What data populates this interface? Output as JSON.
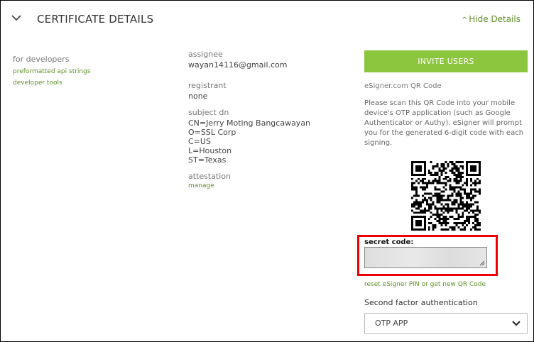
{
  "header": {
    "title": "CERTIFICATE DETAILS",
    "hide_link": "Hide Details"
  },
  "left_panel": {
    "section_title": "for developers",
    "links": [
      "preformatted api strings",
      "developer tools"
    ]
  },
  "details": {
    "assignee_label": "assignee",
    "assignee_value": "wayan14116@gmail.com",
    "registrant_label": "registrant",
    "registrant_value": "none",
    "subject_dn_label": "subject dn",
    "subject_dn_lines": [
      "CN=Jerry Moting Bangcawayan",
      "O=SSL Corp",
      "C=US",
      "L=Houston",
      "ST=Texas"
    ],
    "attestation_label": "attestation",
    "attestation_link": "manage"
  },
  "right_panel": {
    "invite_button": "INVITE USERS",
    "qr_title": "eSigner.com QR Code",
    "qr_description": "Please scan this QR Code into your mobile device's OTP application (such as Google Authenticator or Authy). eSigner will prompt you for the generated 6-digit code with each signing.",
    "secret_label": "secret code:",
    "reset_link": "reset eSigner PIN or get new QR Code",
    "second_factor_label": "Second factor authentication",
    "second_factor_value": "OTP APP"
  },
  "colors": {
    "accent_green": "#8cc63f",
    "link_green": "#5f8f27",
    "highlight_red": "#e00000"
  },
  "icons": [
    "chevron-down-icon",
    "caret-up-icon",
    "qr-code-icon",
    "resize-handle-icon",
    "dropdown-arrow-icon"
  ]
}
